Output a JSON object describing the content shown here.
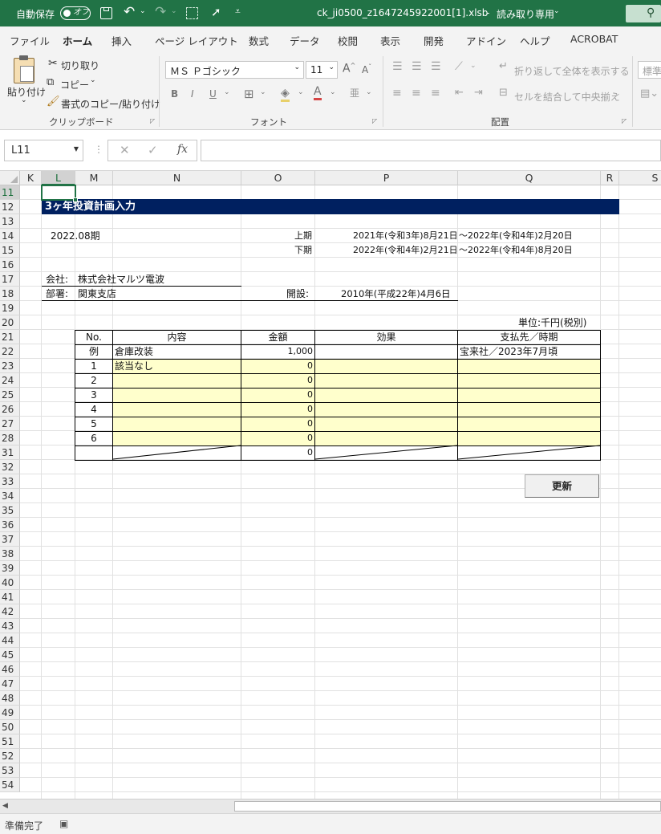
{
  "titlebar": {
    "autosave_label": "自動保存",
    "autosave_state": "オフ",
    "filename": "ck_ji0500_z1647245922001[1].xlsb",
    "sep": "-",
    "readonly": "読み取り専用"
  },
  "tabs": [
    "ファイル",
    "ホーム",
    "挿入",
    "ページ レイアウト",
    "数式",
    "データ",
    "校閲",
    "表示",
    "開発",
    "アドイン",
    "ヘルプ",
    "ACROBAT"
  ],
  "ribbon": {
    "paste": "貼り付け",
    "cut": "切り取り",
    "copy": "コピー",
    "format_painter": "書式のコピー/貼り付け",
    "clipboard_group": "クリップボード",
    "font_name": "ＭＳ Ｐゴシック",
    "font_size": "11",
    "font_group": "フォント",
    "bold": "B",
    "italic": "I",
    "underline": "U",
    "wrap_text": "折り返して全体を表示する",
    "merge_center": "セルを結合して中央揃え",
    "alignment_group": "配置",
    "number_format": "標準"
  },
  "formula_bar": {
    "name_box": "L11",
    "formula": ""
  },
  "columns": [
    "K",
    "L",
    "M",
    "N",
    "O",
    "P",
    "Q",
    "R",
    "S"
  ],
  "rows": [
    "11",
    "12",
    "13",
    "14",
    "15",
    "16",
    "17",
    "18",
    "19",
    "20",
    "21",
    "22",
    "23",
    "24",
    "25",
    "26",
    "27",
    "28",
    "31",
    "32",
    "33",
    "34",
    "35",
    "36",
    "37",
    "38",
    "39",
    "40",
    "41",
    "42",
    "43",
    "44",
    "45",
    "46",
    "47",
    "48",
    "49",
    "50",
    "51",
    "52",
    "53",
    "54"
  ],
  "sheet": {
    "title": "3ヶ年投資計画入力",
    "period": "2022.08期",
    "first_half_label": "上期",
    "first_half_from": "2021年(令和3年)8月21日",
    "first_half_to": "～2022年(令和4年)2月20日",
    "second_half_label": "下期",
    "second_half_from": "2022年(令和4年)2月21日",
    "second_half_to": "～2022年(令和4年)8月20日",
    "company_label": "会社:",
    "company": "株式会社マルツ電波",
    "dept_label": "部署:",
    "dept": "関東支店",
    "established_label": "開設:",
    "established": "2010年(平成22年)4月6日",
    "unit": "単位:千円(税別)",
    "headers": {
      "no": "No.",
      "content": "内容",
      "amount": "金額",
      "effect": "効果",
      "payee": "支払先／時期"
    },
    "example": {
      "no": "例",
      "content": "倉庫改装",
      "amount": "1,000",
      "effect": "",
      "payee": "宝来社／2023年7月頃"
    },
    "items": [
      {
        "no": "1",
        "content": "該当なし",
        "amount": "0"
      },
      {
        "no": "2",
        "content": "",
        "amount": "0"
      },
      {
        "no": "3",
        "content": "",
        "amount": "0"
      },
      {
        "no": "4",
        "content": "",
        "amount": "0"
      },
      {
        "no": "5",
        "content": "",
        "amount": "0"
      },
      {
        "no": "6",
        "content": "",
        "amount": "0"
      }
    ],
    "total_amount": "0",
    "update_button": "更新"
  },
  "status": {
    "ready": "準備完了"
  },
  "colors": {
    "excel_green": "#217346",
    "title_bar": "#002060",
    "input_fill": "#ffffcc"
  }
}
